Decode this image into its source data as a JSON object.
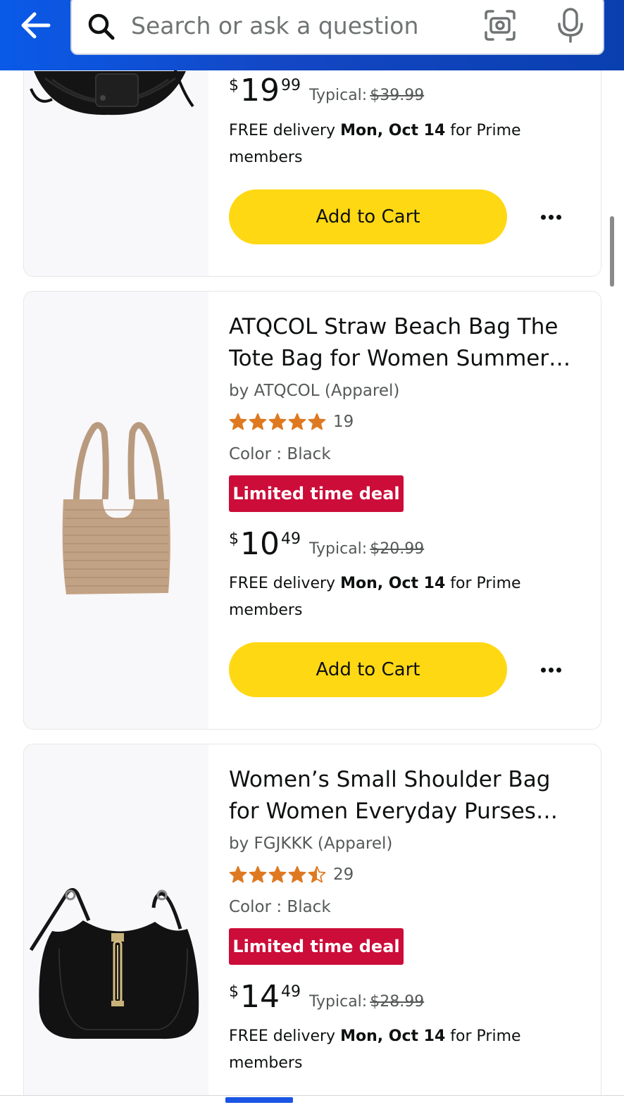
{
  "header": {
    "back_label": "Back",
    "search_placeholder": "Search or ask a question",
    "camera_icon": "camera-scan-icon",
    "mic_icon": "microphone-icon"
  },
  "products": [
    {
      "price": {
        "symbol": "$",
        "whole": "19",
        "fraction": "99",
        "typical_label": "Typical:",
        "typical_value": "$39.99"
      },
      "delivery": {
        "pre": "FREE delivery ",
        "date": "Mon, Oct 14",
        "post": " for Prime members"
      },
      "add_to_cart": "Add to Cart"
    },
    {
      "title_line1": "ATQCOL Straw Beach Bag The",
      "title_line2": "Tote Bag for Women Summer…",
      "brand": "by ATQCOL (Apparel)",
      "rating": 5,
      "rating_count": "19",
      "color": "Color : Black",
      "deal": "Limited time deal",
      "price": {
        "symbol": "$",
        "whole": "10",
        "fraction": "49",
        "typical_label": "Typical:",
        "typical_value": "$20.99"
      },
      "delivery": {
        "pre": "FREE delivery ",
        "date": "Mon, Oct 14",
        "post": " for Prime members"
      },
      "add_to_cart": "Add to Cart"
    },
    {
      "title_line1": "Women’s Small Shoulder Bag",
      "title_line2": "for Women Everyday Purses…",
      "brand": "by FGJKKK (Apparel)",
      "rating": 4.5,
      "rating_count": "29",
      "color": "Color : Black",
      "deal": "Limited time deal",
      "price": {
        "symbol": "$",
        "whole": "14",
        "fraction": "49",
        "typical_label": "Typical:",
        "typical_value": "$28.99"
      },
      "delivery": {
        "pre": "FREE delivery ",
        "date": "Mon, Oct 14",
        "post": " for Prime members"
      }
    }
  ],
  "colors": {
    "header_blue": "#0a5ae8",
    "cart_yellow": "#ffd814",
    "deal_red": "#cc0c39",
    "star_orange": "#de7921"
  }
}
